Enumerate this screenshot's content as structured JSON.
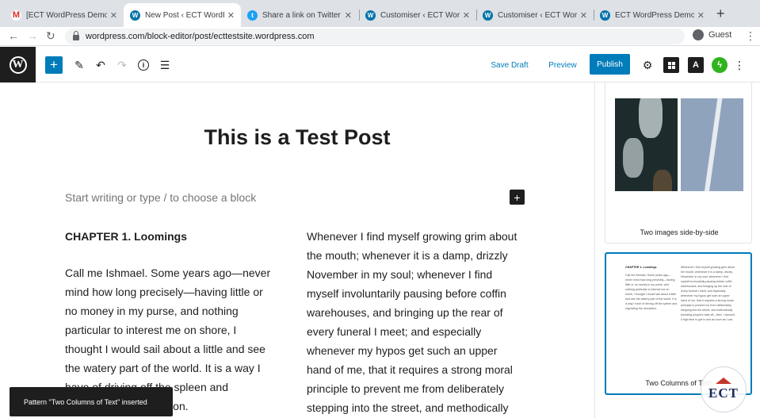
{
  "browser": {
    "tabs": [
      {
        "title": "[ECT WordPress Demo T",
        "icon": "gmail-icon",
        "active": false
      },
      {
        "title": "New Post ‹ ECT WordPr",
        "icon": "wordpress-icon",
        "active": true
      },
      {
        "title": "Share a link on Twitter",
        "icon": "twitter-icon",
        "active": false
      },
      {
        "title": "Customiser ‹ ECT Word",
        "icon": "wordpress-icon",
        "active": false
      },
      {
        "title": "Customiser ‹ ECT Word",
        "icon": "wordpress-icon",
        "active": false
      },
      {
        "title": "ECT WordPress Demo T",
        "icon": "wordpress-icon",
        "active": false
      }
    ],
    "url": "wordpress.com/block-editor/post/ecttestsite.wordpress.com",
    "profile_label": "Guest"
  },
  "editor": {
    "save_draft_label": "Save Draft",
    "preview_label": "Preview",
    "publish_label": "Publish",
    "toolbar_icons": [
      "plus-icon",
      "pencil-icon",
      "undo-icon",
      "redo-icon",
      "info-icon",
      "list-view-icon"
    ],
    "right_icons": [
      "gear-icon",
      "block-icon",
      "a-icon",
      "jetpack-icon",
      "more-icon"
    ]
  },
  "post": {
    "title": "This is a Test Post",
    "placeholder": "Start writing or type / to choose a block",
    "col1_heading": "CHAPTER 1. Loomings",
    "col1_lines": [
      "Call me Ishmael. Some years ago—never",
      "mind how long precisely—having little or",
      "no money in my purse, and nothing",
      "particular to interest me on shore, I",
      "thought I would sail about a little and see",
      "the watery part of the world. It is a way I",
      "have of driving off the spleen and",
      "regulating the circulation."
    ],
    "col2_lines": [
      "Whenever I find myself growing grim about",
      "the mouth; whenever it is a damp, drizzly",
      "November in my soul; whenever I find",
      "myself involuntarily pausing before coffin",
      "warehouses, and bringing up the rear of",
      "every funeral I meet; and especially",
      "whenever my hypos get such an upper",
      "hand of me, that it requires a strong moral",
      "principle to prevent me from deliberately",
      "stepping into the street, and methodically"
    ]
  },
  "sidebar": {
    "pattern1_label": "Two images side-by-side",
    "pattern2_label": "Two Columns of Text",
    "pattern2_preview_heading": "CHAPTER 1. Loomings",
    "pattern2_preview_col1": "Call me Ishmael. Some years ago—never mind how long precisely—having little or no money in my purse, and nothing particular to interest me on shore, I thought I would sail about a little and see the watery part of the world. It is a way I have of driving off the spleen and regulating the circulation.",
    "pattern2_preview_col2": "Whenever I find myself growing grim about the mouth; whenever it is a damp, drizzly November in my soul; whenever I find myself involuntarily pausing before coffin warehouses, and bringing up the rear of every funeral I meet; and especially whenever my hypos get such an upper hand of me, that it requires a strong moral principle to prevent me from deliberately stepping into the street, and methodically knocking people's hats off—then, I account it high time to get to sea as soon as I can."
  },
  "snackbar": {
    "message": "Pattern \"Two Columns of Text\" inserted"
  },
  "watermark": {
    "text": "ECT"
  },
  "colors": {
    "accent": "#007cba",
    "dark": "#1e1e1e",
    "jetpack": "#2fb41f"
  }
}
